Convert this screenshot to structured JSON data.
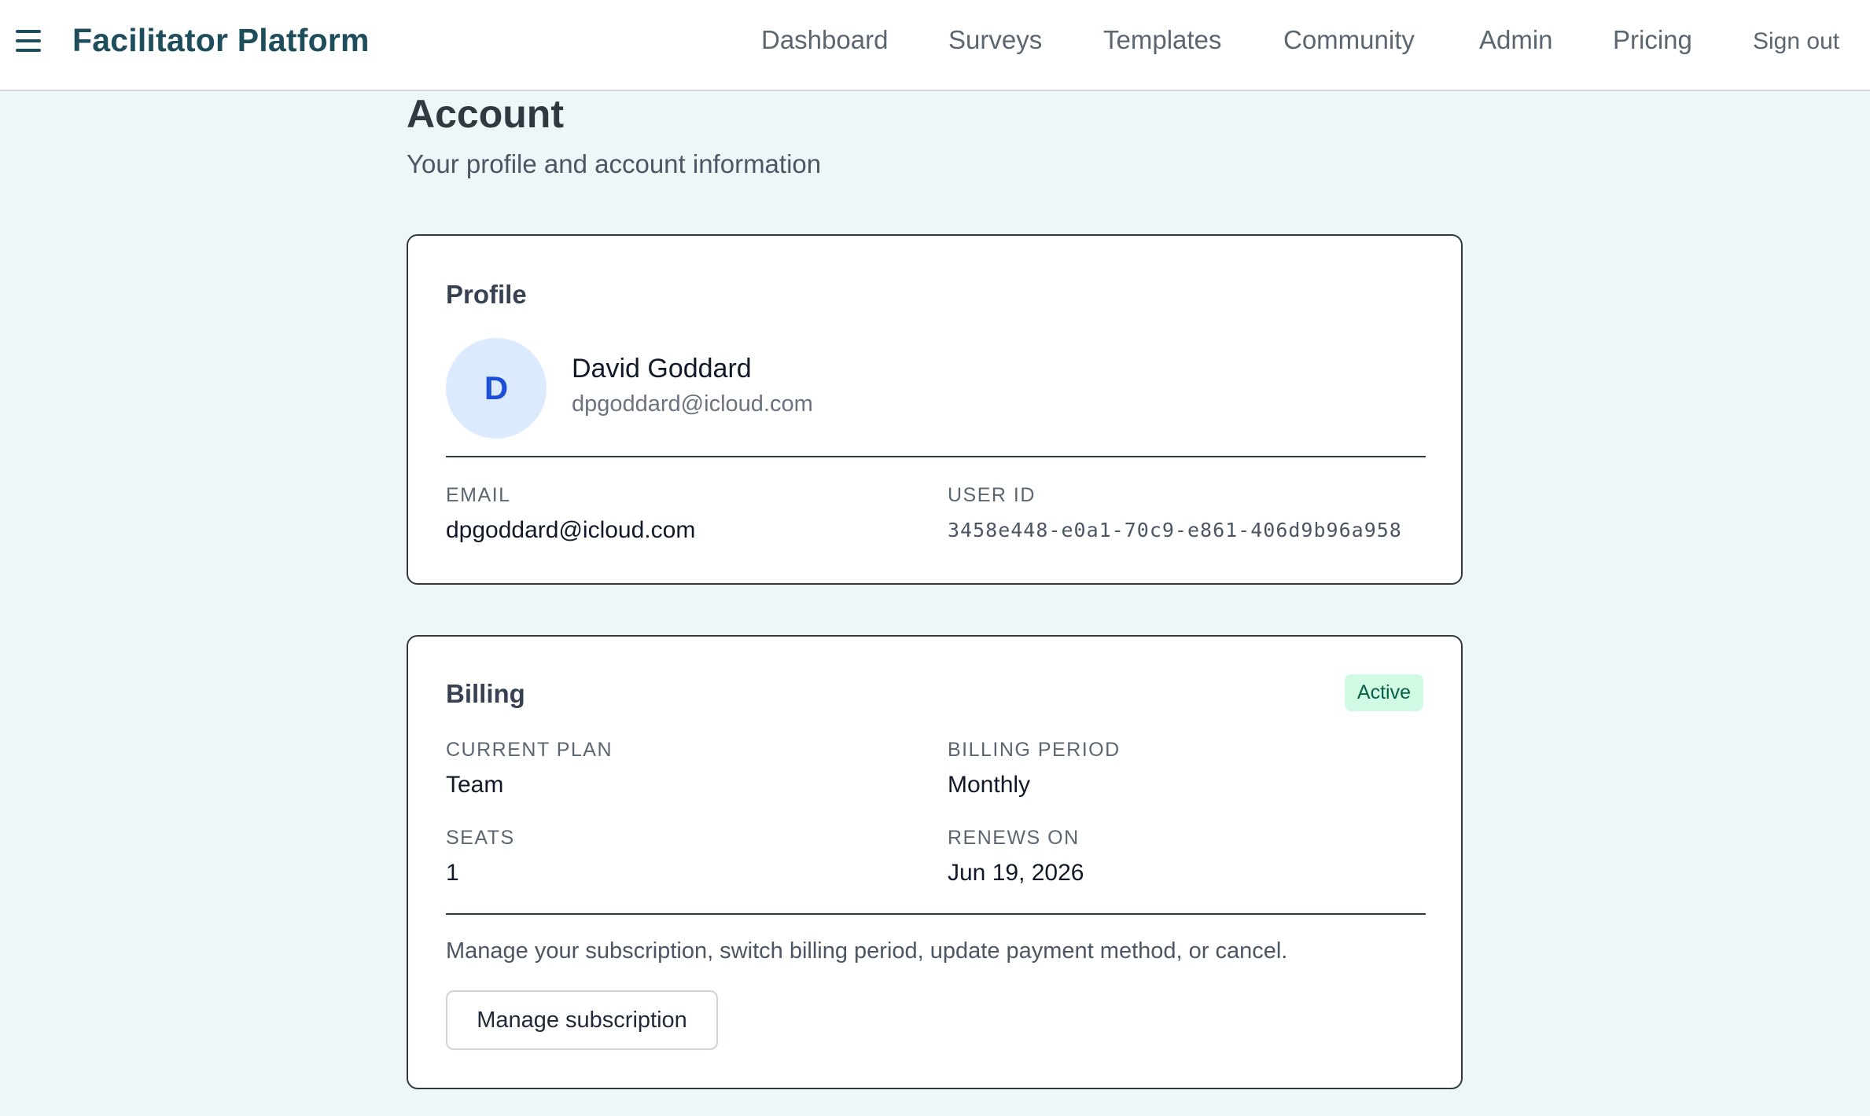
{
  "app": {
    "brand": "Facilitator Platform"
  },
  "nav": {
    "items": [
      "Dashboard",
      "Surveys",
      "Templates",
      "Community",
      "Admin",
      "Pricing"
    ],
    "sign_out": "Sign out"
  },
  "page": {
    "title": "Account",
    "subtitle": "Your profile and account information"
  },
  "profile": {
    "title": "Profile",
    "avatar_initial": "D",
    "name": "David Goddard",
    "email_sub": "dpgoddard@icloud.com",
    "email_label": "EMAIL",
    "email_value": "dpgoddard@icloud.com",
    "user_id_label": "USER ID",
    "user_id_value": "3458e448-e0a1-70c9-e861-406d9b96a958"
  },
  "billing": {
    "title": "Billing",
    "status": "Active",
    "plan_label": "CURRENT PLAN",
    "plan_value": "Team",
    "period_label": "BILLING PERIOD",
    "period_value": "Monthly",
    "seats_label": "SEATS",
    "seats_value": "1",
    "renews_label": "RENEWS ON",
    "renews_value": "Jun 19, 2026",
    "note": "Manage your subscription, switch billing period, update payment method, or cancel.",
    "manage_button": "Manage subscription"
  },
  "colors": {
    "brand": "#1e4d5c",
    "background": "#eef6f7",
    "avatar_bg": "#dbeafe",
    "avatar_fg": "#1d4ed8",
    "badge_bg": "#d1fae5",
    "badge_fg": "#065f46"
  },
  "icons": {
    "menu": "hamburger-menu-icon"
  }
}
